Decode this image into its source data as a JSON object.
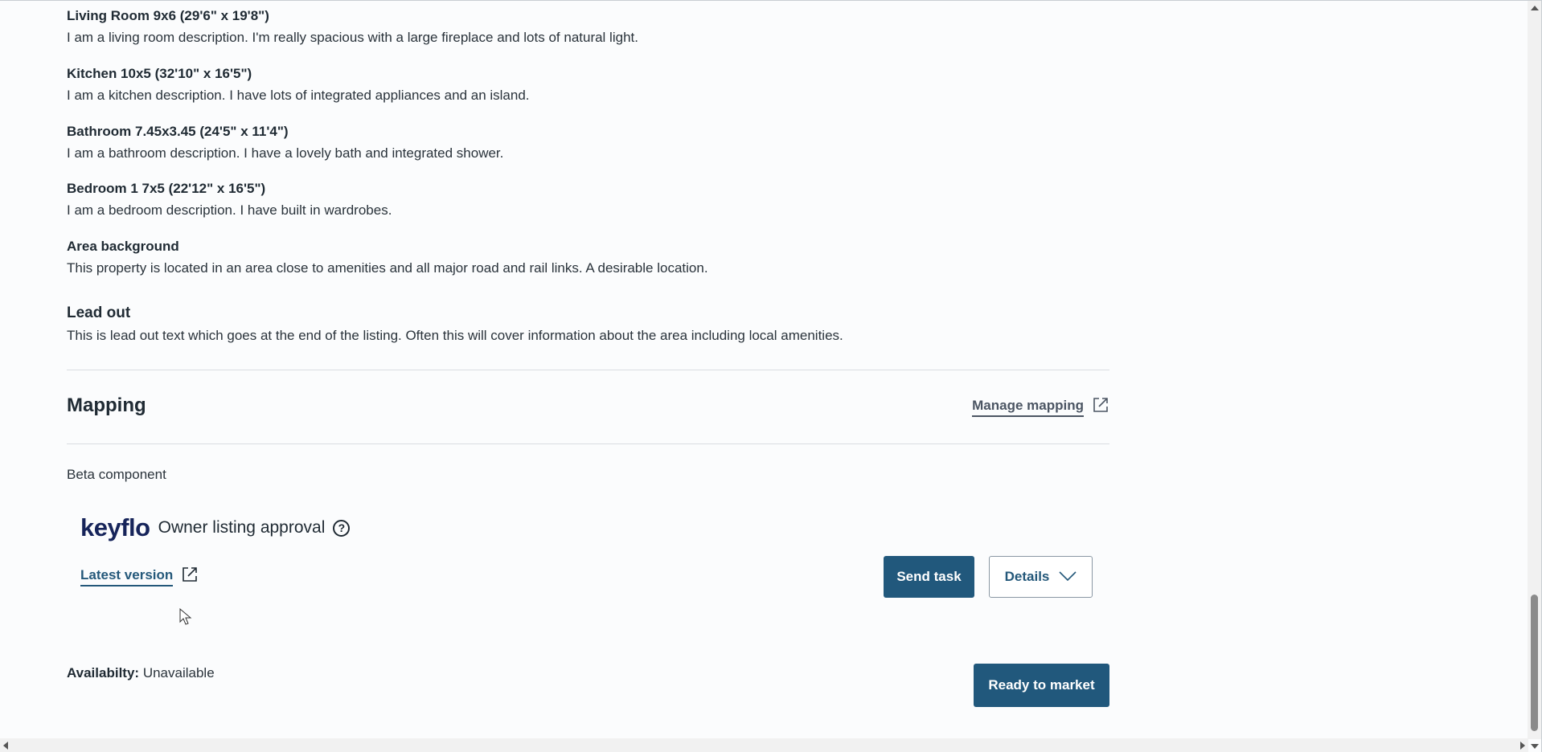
{
  "rooms": [
    {
      "title": "Living Room 9x6 (29'6\" x 19'8\")",
      "description": "I am a living room description. I'm really spacious with a large fireplace and lots of natural light."
    },
    {
      "title": "Kitchen 10x5 (32'10\" x 16'5\")",
      "description": "I am a kitchen description. I have lots of integrated appliances and an island."
    },
    {
      "title": "Bathroom 7.45x3.45 (24'5\" x 11'4\")",
      "description": "I am a bathroom description. I have a lovely bath and integrated shower."
    },
    {
      "title": "Bedroom 1 7x5 (22'12\" x 16'5\")",
      "description": "I am a bedroom description. I have built in wardrobes."
    }
  ],
  "area_background": {
    "title": "Area background",
    "description": "This property is located in an area close to amenities and all major road and rail links. A desirable location."
  },
  "lead_out": {
    "title": "Lead out",
    "description": "This is lead out text which goes at the end of the listing. Often this will cover information about the area including local amenities."
  },
  "mapping": {
    "title": "Mapping",
    "manage_link": "Manage mapping",
    "beta_label": "Beta component"
  },
  "keyflo": {
    "logo": "keyflo",
    "label": "Owner listing approval",
    "help_glyph": "?",
    "latest_version": "Latest version",
    "send_task": "Send task",
    "details": "Details"
  },
  "availability": {
    "label": "Availabilty:",
    "value": "Unavailable"
  },
  "ready_to_market": "Ready to market",
  "colors": {
    "primary": "#21587c",
    "keyflo_brand": "#16245a",
    "text": "#1f2a33",
    "divider": "#d9dde1"
  },
  "icons": {
    "external_link": "external-link-icon",
    "chevron": "chevron-down-icon",
    "help": "help-circle-icon",
    "cursor": "mouse-pointer-icon"
  }
}
